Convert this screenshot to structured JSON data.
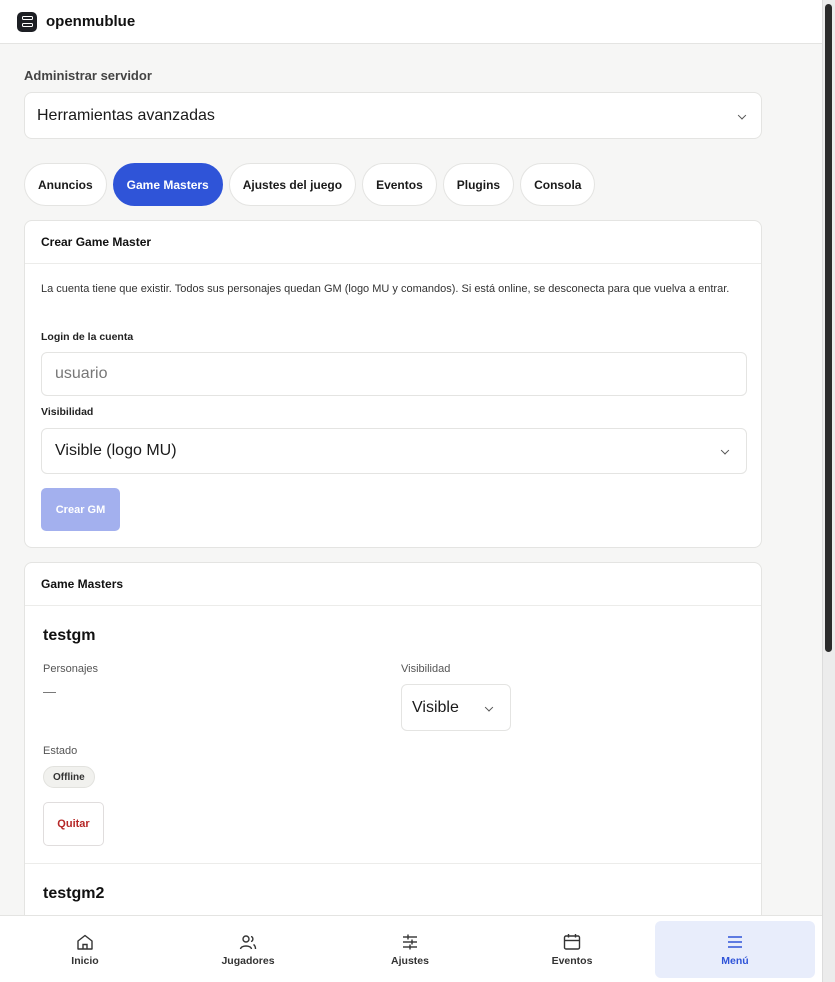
{
  "app": {
    "brand": "openmublue"
  },
  "admin": {
    "section_label": "Administrar servidor",
    "selected_tool": "Herramientas avanzadas"
  },
  "tabs": [
    {
      "label": "Anuncios",
      "active": false
    },
    {
      "label": "Game Masters",
      "active": true
    },
    {
      "label": "Ajustes del juego",
      "active": false
    },
    {
      "label": "Eventos",
      "active": false
    },
    {
      "label": "Plugins",
      "active": false
    },
    {
      "label": "Consola",
      "active": false
    }
  ],
  "create_gm": {
    "title": "Crear Game Master",
    "description": "La cuenta tiene que existir. Todos sus personajes quedan GM (logo MU y comandos). Si está online, se desconecta para que vuelva a entrar.",
    "login_label": "Login de la cuenta",
    "login_placeholder": "usuario",
    "login_value": "",
    "visibility_label": "Visibilidad",
    "visibility_value": "Visible (logo MU)",
    "submit_label": "Crear GM"
  },
  "gm_list": {
    "title": "Game Masters",
    "characters_label": "Personajes",
    "visibility_label": "Visibilidad",
    "status_label": "Estado",
    "remove_label": "Quitar",
    "items": [
      {
        "name": "testgm",
        "characters": "—",
        "visibility": "Visible",
        "status": "Offline"
      },
      {
        "name": "testgm2"
      }
    ]
  },
  "bottom_nav": [
    {
      "label": "Inicio",
      "icon": "home-icon",
      "active": false
    },
    {
      "label": "Jugadores",
      "icon": "users-icon",
      "active": false
    },
    {
      "label": "Ajustes",
      "icon": "sliders-icon",
      "active": false
    },
    {
      "label": "Eventos",
      "icon": "calendar-icon",
      "active": false
    },
    {
      "label": "Menú",
      "icon": "menu-icon",
      "active": true
    }
  ],
  "colors": {
    "accent": "#2f54d8",
    "accent_disabled": "#a3b0ee",
    "danger": "#b62828",
    "background": "#f6f6f5"
  }
}
